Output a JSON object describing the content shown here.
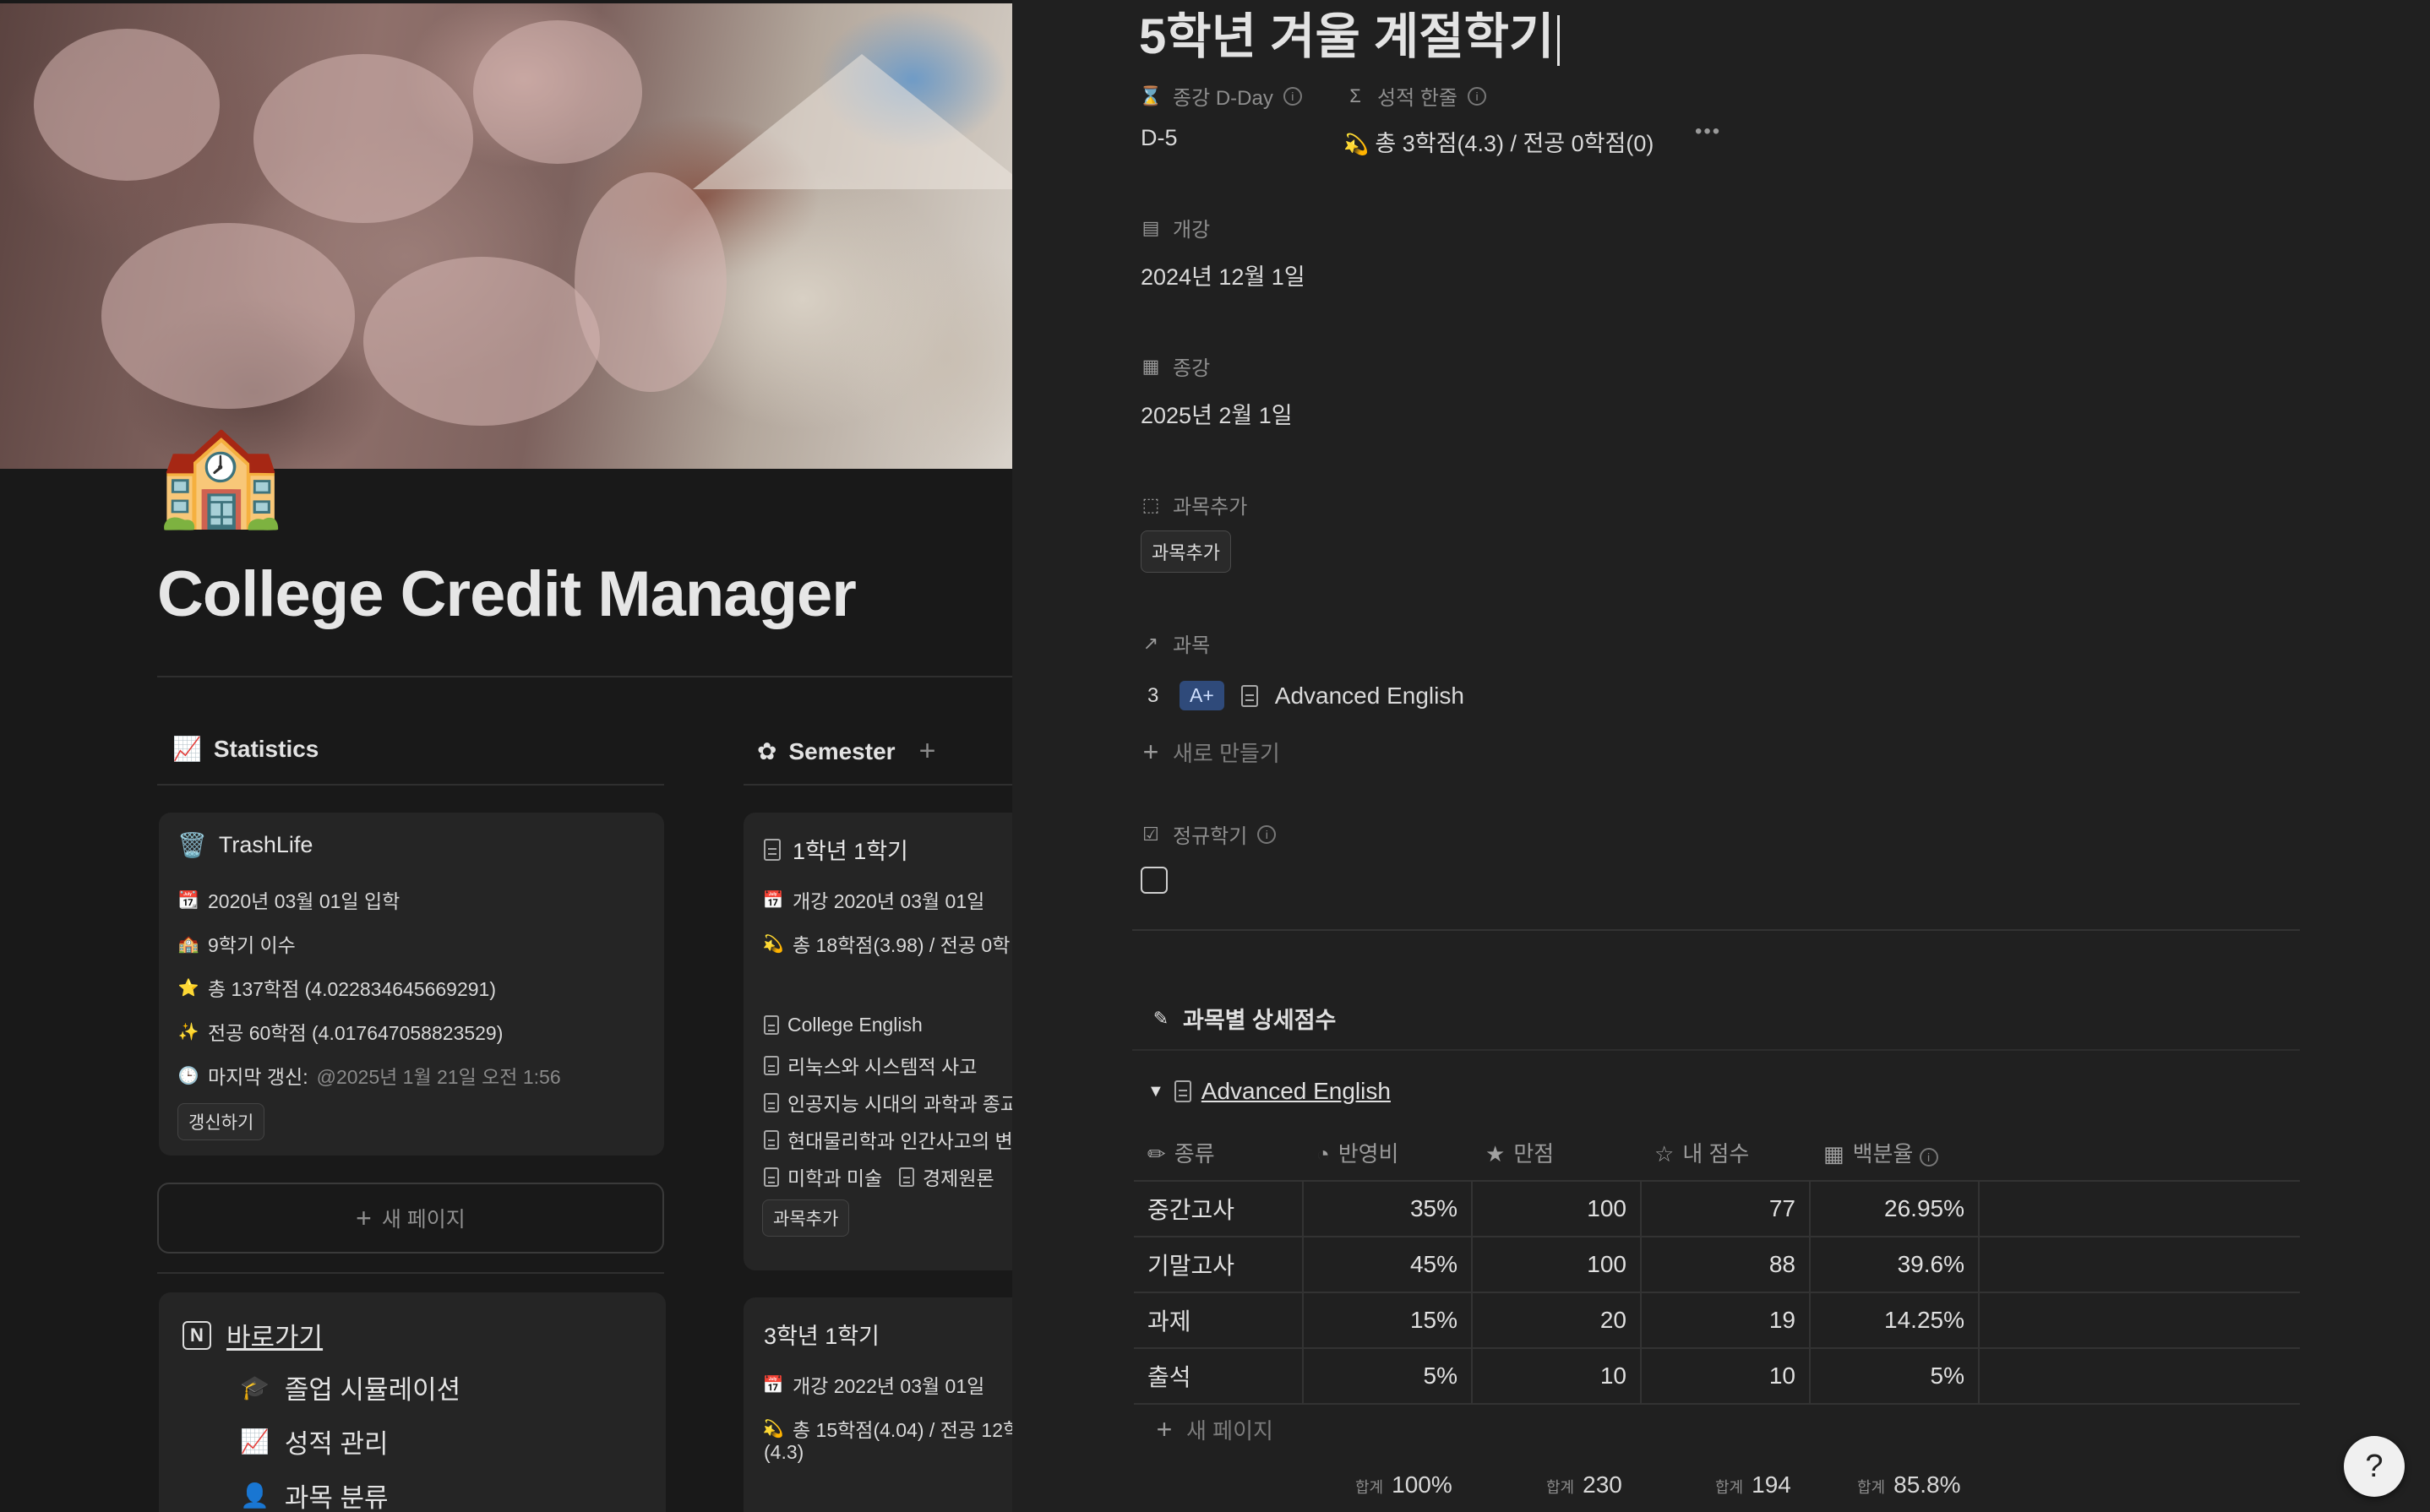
{
  "left": {
    "page_icon": "🏫",
    "page_title": "College Credit Manager",
    "statistics": {
      "heading": "Statistics",
      "card": {
        "title": "TrashLife",
        "lines": [
          {
            "emoji": "📆",
            "text": "2020년 03월 01일 입학"
          },
          {
            "emoji": "🏫",
            "text": "9학기 이수"
          },
          {
            "emoji": "⭐",
            "text": "총 137학점 (4.022834645669291)"
          },
          {
            "emoji": "✨",
            "text": "전공 60학점 (4.017647058823529)"
          }
        ],
        "last_update_label": "마지막 갱신:",
        "last_update_value": "@2025년 1월 21일 오전 1:56",
        "refresh_button": "갱신하기"
      },
      "new_page": "새 페이지"
    },
    "semester": {
      "heading": "Semester",
      "add": "+",
      "card1": {
        "title": "1학년 1학기",
        "start": "개강 2020년 03월 01일",
        "credits": "총 18학점(3.98) / 전공 0학",
        "courses": [
          "College English",
          "리눅스와 시스템적 사고",
          "인공지능 시대의 과학과 종교",
          "현대물리학과 인간사고의 변",
          "미학과 미술",
          "경제원론"
        ],
        "add_course": "과목추가"
      },
      "card2": {
        "title": "3학년 1학기",
        "start": "개강 2022년 03월 01일",
        "credits": "총 15학점(4.04) / 전공 12학",
        "credits2": "(4.3)"
      }
    },
    "shortcuts": {
      "heading": "바로가기",
      "items": [
        "졸업 시뮬레이션",
        "성적 관리",
        "과목 분류"
      ]
    }
  },
  "peek": {
    "title": "5학년 겨울 계절학기",
    "dday_label": "종강 D-Day",
    "dday_value": "D-5",
    "grade_label": "성적 한줄",
    "grade_value": "총 3학점(4.3) / 전공 0학점(0)",
    "more": "•••",
    "start_label": "개강",
    "start_value": "2024년 12월 1일",
    "end_label": "종강",
    "end_value": "2025년 2월 1일",
    "add_course_label": "과목추가",
    "add_course_button": "과목추가",
    "courses_label": "과목",
    "course": {
      "credits": "3",
      "grade": "A+",
      "name": "Advanced English"
    },
    "new_item": "새로 만들기",
    "regular_label": "정규학기",
    "detail_heading": "과목별 상세점수",
    "detail_course": "Advanced English",
    "columns": [
      "종류",
      "반영비",
      "만점",
      "내 점수",
      "백분율"
    ],
    "rows": [
      [
        "중간고사",
        "35%",
        "100",
        "77",
        "26.95%"
      ],
      [
        "기말고사",
        "45%",
        "100",
        "88",
        "39.6%"
      ],
      [
        "과제",
        "15%",
        "20",
        "19",
        "14.25%"
      ],
      [
        "출석",
        "5%",
        "10",
        "10",
        "5%"
      ]
    ],
    "new_row": "새 페이지",
    "sum_label": "합계",
    "sums": [
      "100%",
      "230",
      "194",
      "85.8%"
    ]
  },
  "help_icon": "?"
}
